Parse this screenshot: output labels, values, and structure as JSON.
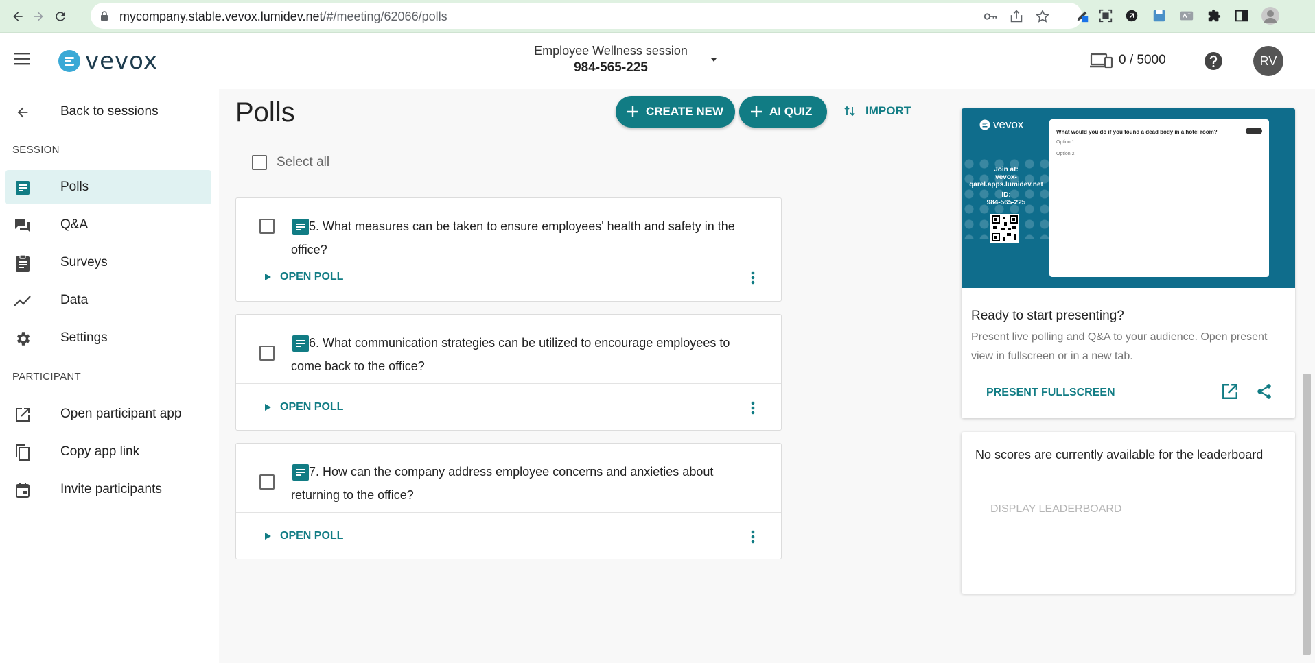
{
  "browser": {
    "url_host": "mycompany.stable.vevox.lumidev.net",
    "url_path": "/#/meeting/62066/polls"
  },
  "header": {
    "logo_text": "vevox",
    "session_title": "Employee Wellness session",
    "session_id": "984-565-225",
    "participants_count": "0 / 5000",
    "avatar_initials": "RV"
  },
  "sidebar": {
    "back_label": "Back to sessions",
    "session_section": "SESSION",
    "participant_section": "PARTICIPANT",
    "items": [
      {
        "label": "Polls",
        "icon": "poll-icon"
      },
      {
        "label": "Q&A",
        "icon": "chat-icon"
      },
      {
        "label": "Surveys",
        "icon": "clipboard-icon"
      },
      {
        "label": "Data",
        "icon": "trend-icon"
      },
      {
        "label": "Settings",
        "icon": "gear-icon"
      }
    ],
    "participant_items": [
      {
        "label": "Open participant app",
        "icon": "open-external-icon"
      },
      {
        "label": "Copy app link",
        "icon": "copy-icon"
      },
      {
        "label": "Invite participants",
        "icon": "calendar-icon"
      }
    ]
  },
  "main": {
    "title": "Polls",
    "create_new_label": "CREATE NEW",
    "ai_quiz_label": "AI QUIZ",
    "import_label": "IMPORT",
    "select_all_label": "Select all",
    "polls": [
      {
        "question": "5. What measures can be taken to ensure employees' health and safety in the office?",
        "action": "OPEN POLL"
      },
      {
        "question": "6. What communication strategies can be utilized to encourage employees to come back to the office?",
        "action": "OPEN POLL"
      },
      {
        "question": "7. How can the company address employee concerns and anxieties about returning to the office?",
        "action": "OPEN POLL"
      }
    ]
  },
  "present": {
    "preview_logo": "vevox",
    "preview_join": "Join at:",
    "preview_join_url": "vevox-qarel.apps.lumidev.net",
    "preview_id_label": "ID:",
    "preview_id": "984-565-225",
    "preview_question": "What would you do if you found a dead body in a hotel room?",
    "preview_options": [
      "Option 1",
      "Option 2"
    ],
    "title": "Ready to start presenting?",
    "description": "Present live polling and Q&A to your audience. Open present view in fullscreen or in a new tab.",
    "fullscreen_label": "PRESENT FULLSCREEN"
  },
  "leaderboard": {
    "message": "No scores are currently available for the leaderboard",
    "button_label": "DISPLAY LEADERBOARD"
  },
  "colors": {
    "accent": "#117c84",
    "active_bg": "#e0f2f2",
    "browser_bar": "#dff1e1",
    "preview_bg": "#0f6d8c"
  }
}
